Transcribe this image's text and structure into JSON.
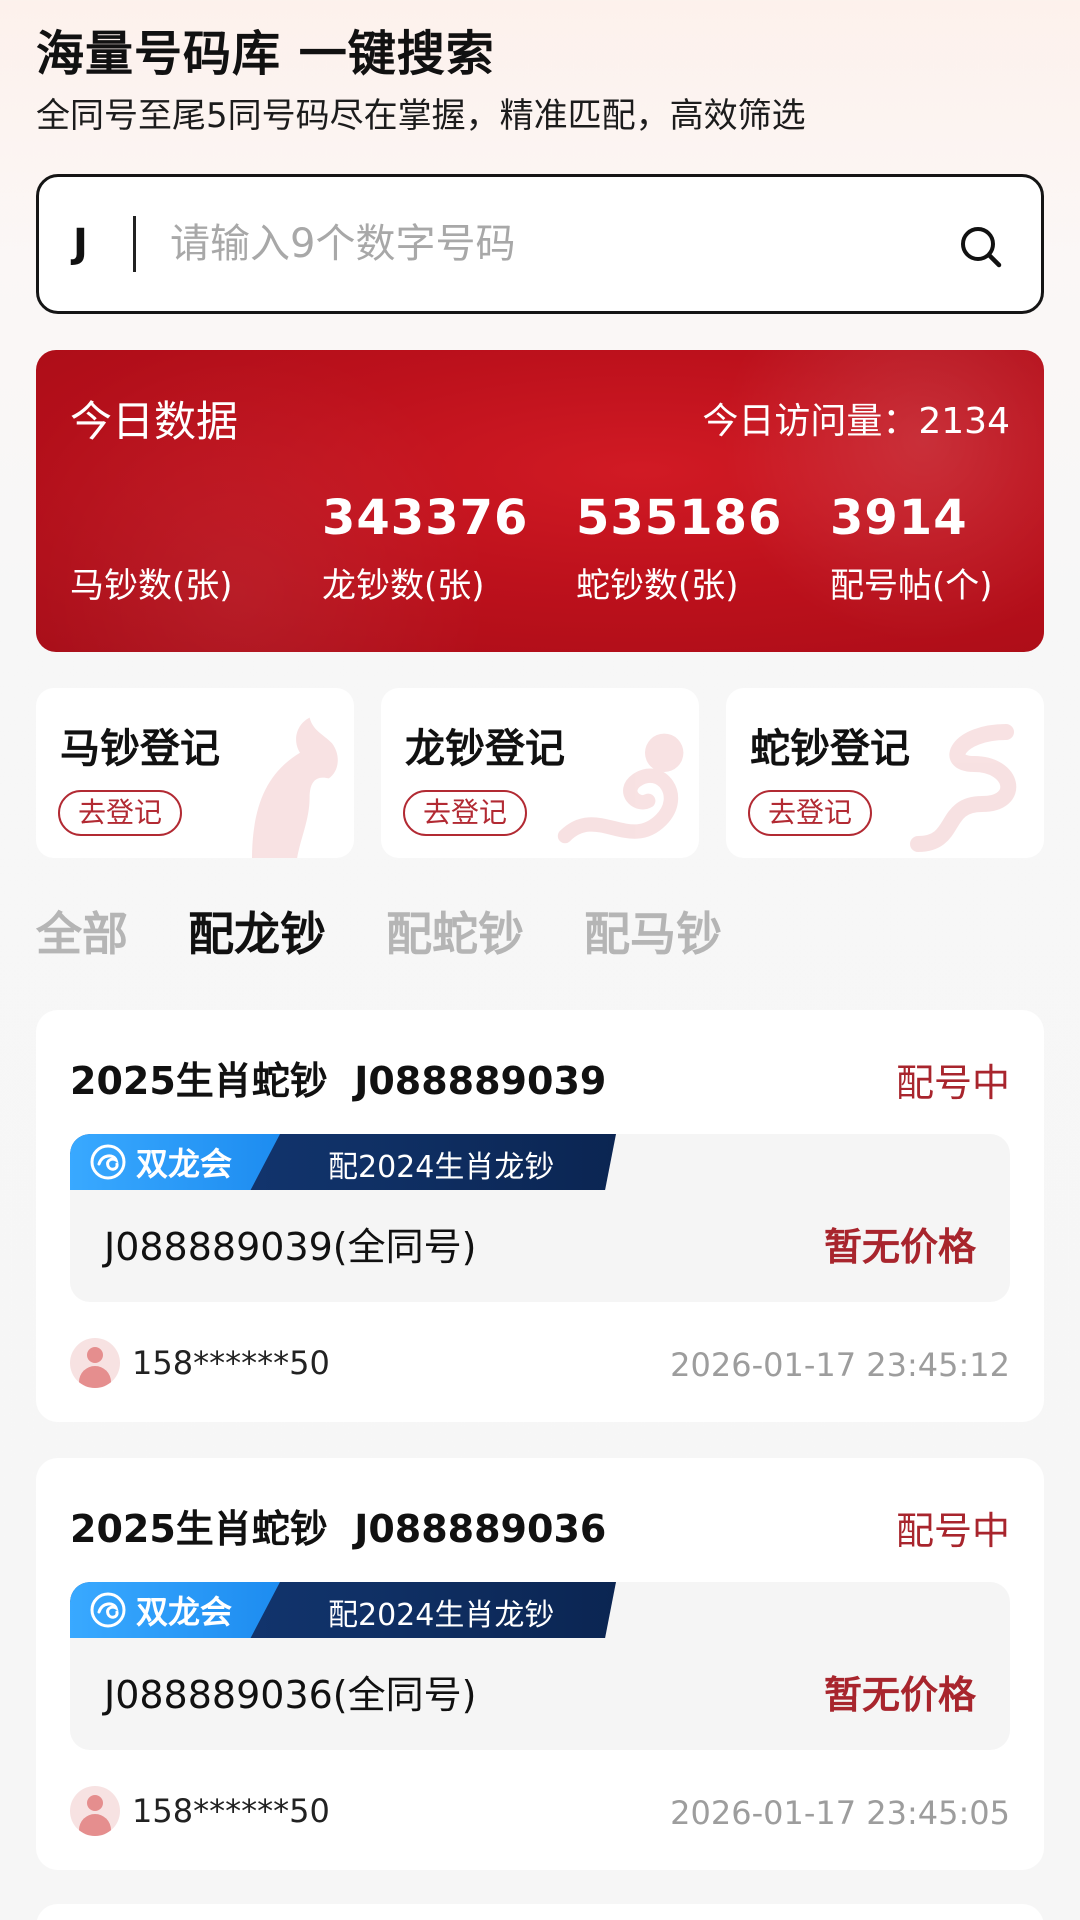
{
  "header": {
    "title": "海量号码库 一键搜索",
    "subtitle": "全同号至尾5同号码尽在掌握，精准匹配，高效筛选"
  },
  "search": {
    "prefix": "J",
    "placeholder": "请输入9个数字号码",
    "value": ""
  },
  "stats": {
    "title": "今日数据",
    "visits_label": "今日访问量：2134",
    "items": [
      {
        "value": "",
        "label": "马钞数(张)"
      },
      {
        "value": "343376",
        "label": "龙钞数(张)"
      },
      {
        "value": "535186",
        "label": "蛇钞数(张)"
      },
      {
        "value": "3914",
        "label": "配号帖(个)"
      }
    ]
  },
  "register_cards": [
    {
      "title": "马钞登记",
      "button": "去登记",
      "icon": "horse-icon"
    },
    {
      "title": "龙钞登记",
      "button": "去登记",
      "icon": "dragon-icon"
    },
    {
      "title": "蛇钞登记",
      "button": "去登记",
      "icon": "snake-icon"
    }
  ],
  "tabs": [
    {
      "label": "全部",
      "active": false
    },
    {
      "label": "配龙钞",
      "active": true
    },
    {
      "label": "配蛇钞",
      "active": false
    },
    {
      "label": "配马钞",
      "active": false
    }
  ],
  "listings": [
    {
      "title": "2025生肖蛇钞  J088889039",
      "status": "配号中",
      "club": "双龙会",
      "pair_text": "配2024生肖龙钞",
      "number": "J088889039(全同号)",
      "price": "暂无价格",
      "user": "158******50",
      "time": "2026-01-17 23:45:12"
    },
    {
      "title": "2025生肖蛇钞  J088889036",
      "status": "配号中",
      "club": "双龙会",
      "pair_text": "配2024生肖龙钞",
      "number": "J088889036(全同号)",
      "price": "暂无价格",
      "user": "158******50",
      "time": "2026-01-17 23:45:05"
    }
  ],
  "colors": {
    "brand_red": "#bd111c",
    "status_red": "#a8252d",
    "club_blue": "#1d8cf0",
    "bar_navy": "#0f2f63"
  }
}
